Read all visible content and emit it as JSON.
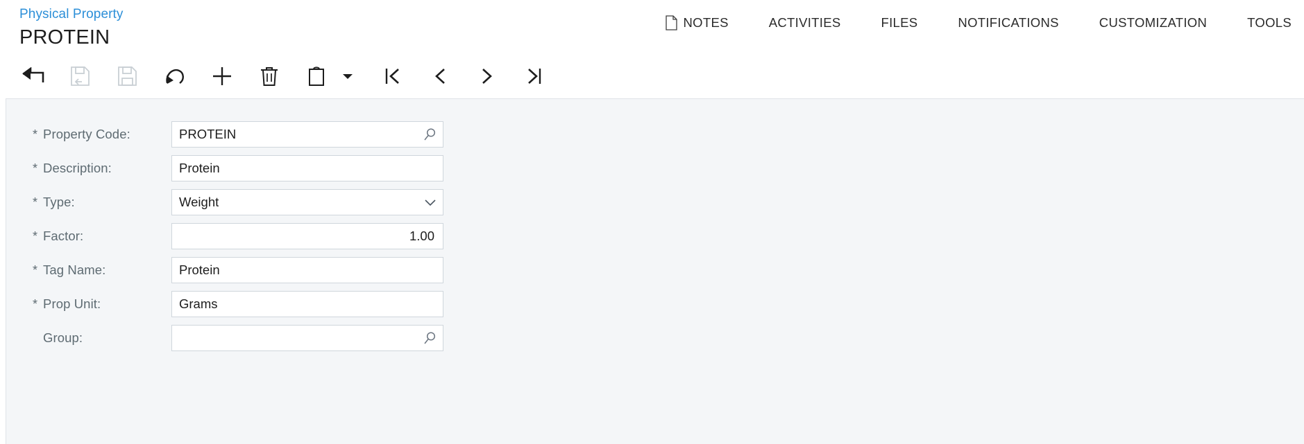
{
  "header": {
    "breadcrumb": "Physical Property",
    "page_title": "PROTEIN",
    "nav": [
      {
        "label": "NOTES",
        "icon": "note-icon"
      },
      {
        "label": "ACTIVITIES",
        "icon": ""
      },
      {
        "label": "FILES",
        "icon": ""
      },
      {
        "label": "NOTIFICATIONS",
        "icon": ""
      },
      {
        "label": "CUSTOMIZATION",
        "icon": ""
      },
      {
        "label": "TOOLS",
        "icon": ""
      }
    ]
  },
  "toolbar": {
    "buttons": [
      {
        "name": "back-button",
        "icon": "back-arrow-icon",
        "label": "Back",
        "disabled": false
      },
      {
        "name": "save-and-back-button",
        "icon": "save-and-back-icon",
        "label": "Save and Back",
        "disabled": true
      },
      {
        "name": "save-button",
        "icon": "save-icon",
        "label": "Save",
        "disabled": true
      },
      {
        "name": "cancel-button",
        "icon": "undo-arrow-icon",
        "label": "Cancel",
        "disabled": false
      },
      {
        "name": "insert-button",
        "icon": "plus-icon",
        "label": "Insert",
        "disabled": false
      },
      {
        "name": "delete-button",
        "icon": "trash-icon",
        "label": "Delete",
        "disabled": false
      },
      {
        "name": "clipboard-button",
        "icon": "clipboard-icon",
        "label": "Clipboard",
        "disabled": false
      },
      {
        "name": "clipboard-dropdown",
        "icon": "chevron-down-icon",
        "label": "Clipboard Menu",
        "disabled": false
      },
      {
        "name": "first-record-button",
        "icon": "first-page-icon",
        "label": "First",
        "disabled": false
      },
      {
        "name": "previous-record-button",
        "icon": "chevron-left-icon",
        "label": "Previous",
        "disabled": false
      },
      {
        "name": "next-record-button",
        "icon": "chevron-right-icon",
        "label": "Next",
        "disabled": false
      },
      {
        "name": "last-record-button",
        "icon": "last-page-icon",
        "label": "Last",
        "disabled": false
      }
    ]
  },
  "form": {
    "fields": [
      {
        "name": "property-code",
        "label": "Property Code:",
        "required": true,
        "value": "PROTEIN",
        "control": "lookup",
        "align": "left",
        "icon": "search-icon"
      },
      {
        "name": "description",
        "label": "Description:",
        "required": true,
        "value": "Protein",
        "control": "text",
        "align": "left",
        "icon": ""
      },
      {
        "name": "type",
        "label": "Type:",
        "required": true,
        "value": "Weight",
        "control": "select",
        "align": "left",
        "icon": "chevron-down-icon"
      },
      {
        "name": "factor",
        "label": "Factor:",
        "required": true,
        "value": "1.00",
        "control": "number",
        "align": "right",
        "icon": ""
      },
      {
        "name": "tag-name",
        "label": "Tag Name:",
        "required": true,
        "value": "Protein",
        "control": "text",
        "align": "left",
        "icon": ""
      },
      {
        "name": "prop-unit",
        "label": "Prop Unit:",
        "required": true,
        "value": "Grams",
        "control": "text",
        "align": "left",
        "icon": ""
      },
      {
        "name": "group",
        "label": "Group:",
        "required": false,
        "value": "",
        "control": "lookup",
        "align": "left",
        "icon": "search-icon"
      }
    ]
  },
  "colors": {
    "link": "#2c8fd8",
    "body_bg": "#f4f6f8",
    "field_border": "#cfd6dc",
    "label_text": "#5e6b72",
    "disabled_icon": "#c9cfd4"
  }
}
